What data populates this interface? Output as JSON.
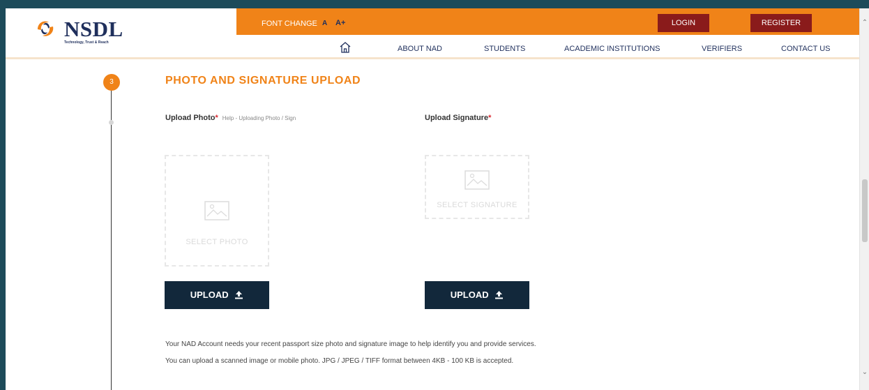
{
  "header": {
    "logo_text": "NSDL",
    "logo_tagline": "Technology, Trust & Reach",
    "font_change_label": "FONT CHANGE",
    "font_small": "A",
    "font_large": "A+",
    "login": "LOGIN",
    "register": "REGISTER"
  },
  "nav": {
    "home_icon": "home-icon",
    "items": [
      "ABOUT NAD",
      "STUDENTS",
      "ACADEMIC INSTITUTIONS",
      "VERIFIERS",
      "CONTACT US"
    ]
  },
  "step": {
    "number": "3",
    "title": "PHOTO AND SIGNATURE UPLOAD"
  },
  "photo": {
    "label": "Upload Photo",
    "required": "*",
    "help": "Help - Uploading Photo / Sign",
    "placeholder": "SELECT PHOTO",
    "upload": "UPLOAD"
  },
  "signature": {
    "label": "Upload Signature",
    "required": "*",
    "placeholder": "SELECT SIGNATURE",
    "upload": "UPLOAD"
  },
  "info": {
    "line1": "Your NAD Account needs your recent passport size photo and signature image to help identify you and provide services.",
    "line2": "You can upload a scanned image or mobile photo. JPG / JPEG / TIFF format between 4KB - 100 KB is accepted."
  },
  "colors": {
    "accent": "#f08318",
    "navy": "#1f2f5c",
    "button_dark": "#12283b",
    "button_red": "#8a1b1b",
    "required": "#d9282f"
  }
}
